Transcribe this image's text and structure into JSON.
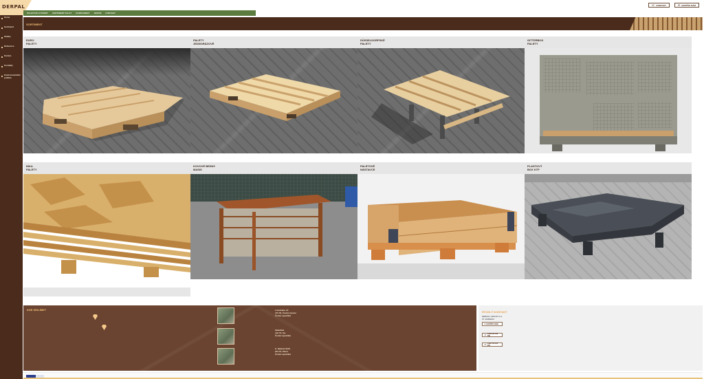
{
  "brand": {
    "logo_text": "DERPAL"
  },
  "sidebar": {
    "items": [
      {
        "label": "Home"
      },
      {
        "label": "Sortiment"
      },
      {
        "label": "Služby"
      },
      {
        "label": "Reference"
      },
      {
        "label": "Kariéra"
      },
      {
        "label": "Kontakty"
      },
      {
        "label": "Environmentální\npolitika"
      }
    ]
  },
  "topnav": {
    "items": [
      "PALETOVÉ SYSTÉMY",
      "SORTIMENT PALET",
      "KONTEJNERY",
      "SERVIS",
      "KONTAKT"
    ]
  },
  "top_actions": {
    "phone_label": "KONTAKT",
    "email_label": "NAPIŠTE NÁM"
  },
  "section": {
    "title": "SORTIMENT"
  },
  "products": [
    {
      "title": "EURO\nPALETY",
      "scene": "euro"
    },
    {
      "title": "PALETY\nJEDNORÁZOVÉ",
      "scene": "oneway"
    },
    {
      "title": "DÜSSELDORFSKÉ\nPALETY",
      "scene": "dusseldorf"
    },
    {
      "title": "GITTERBOX\nPALETY",
      "scene": "gitterbox"
    },
    {
      "title": "INKA\nPALETY",
      "scene": "inka"
    },
    {
      "title": "KOVOVÉ BEDNY\nMASIS",
      "scene": "metalbox"
    },
    {
      "title": "PALETOVÉ\nNÁSTAVCE",
      "scene": "collar"
    },
    {
      "title": "PLASTOVÝ\nBOX KTP",
      "scene": "plastic"
    }
  ],
  "footer": {
    "title": "KDE SÍDLÍME?",
    "addresses": [
      "Lhotského 13\n170 00, Česká Lipnice\nČeská republika",
      "Skladiště\nJoli 15, fax\nČeská republika",
      "K. Nádraží 2001\n313 16, Plzeň\nČeská republika"
    ]
  },
  "contact": {
    "title": "RYCHLÝ KONTAKT",
    "company": "DERPAL GROUP A.S.\nIČ: 26089201",
    "buttons": [
      {
        "label": "NAPIŠTE NÁM"
      },
      {
        "label": "+420 123 456 789"
      },
      {
        "label": "+420 723 123 456"
      }
    ]
  },
  "colors": {
    "brand_brown": "#4b2c1c",
    "accent_orange": "#f2bf78",
    "nav_green": "#5b7b3f"
  }
}
